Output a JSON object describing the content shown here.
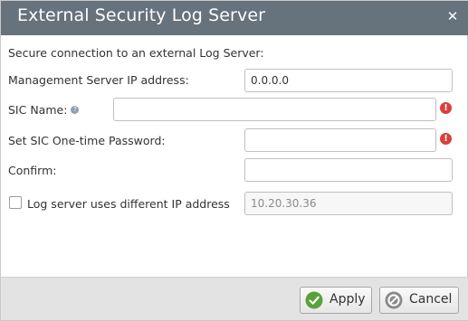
{
  "dialog": {
    "title": "External Security Log Server",
    "close_glyph": "✕"
  },
  "form": {
    "intro": "Secure connection to an external Log Server:",
    "mgmt_ip_label": "Management Server IP address:",
    "mgmt_ip_value": "0.0.0.0",
    "sic_name_label": "SIC Name:",
    "sic_name_help": "?",
    "sic_name_value": "",
    "otp_label": "Set SIC One-time Password:",
    "otp_value": "",
    "confirm_label": "Confirm:",
    "confirm_value": "",
    "diff_ip_label": "Log server uses different IP address",
    "diff_ip_checked": false,
    "diff_ip_value": "10.20.30.36",
    "error_glyph": "!"
  },
  "footer": {
    "apply_label": "Apply",
    "cancel_label": "Cancel"
  },
  "colors": {
    "titlebar": "#66727c",
    "error": "#d9403a",
    "apply_icon": "#5aa13a",
    "cancel_icon": "#8a8a8a"
  },
  "icons": [
    "close-icon",
    "help-icon",
    "error-icon",
    "checkmark-icon",
    "cancel-icon"
  ]
}
